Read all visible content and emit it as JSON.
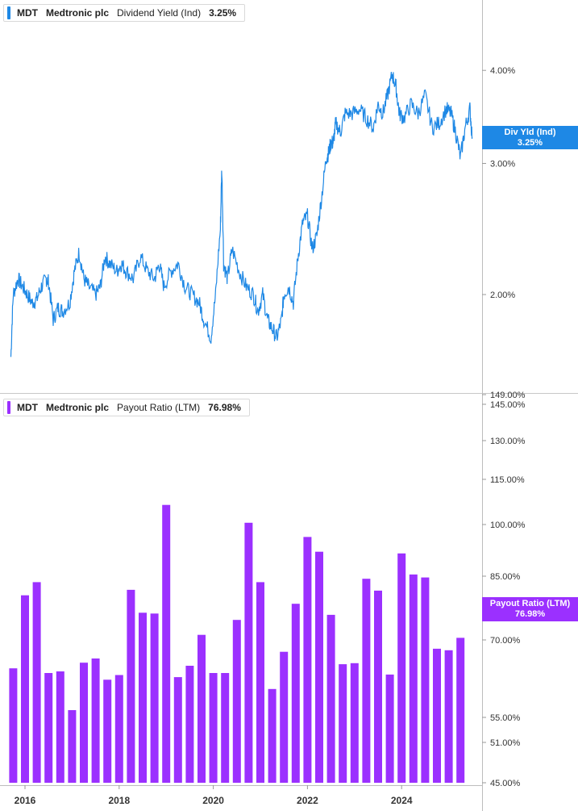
{
  "legend_top": {
    "ticker": "MDT",
    "company": "Medtronic plc",
    "metric": "Dividend Yield (Ind)",
    "value": "3.25%"
  },
  "legend_bottom": {
    "ticker": "MDT",
    "company": "Medtronic plc",
    "metric": "Payout Ratio (LTM)",
    "value": "76.98%"
  },
  "tag_top": {
    "line1": "Div Yld (Ind)",
    "line2": "3.25%"
  },
  "tag_bottom": {
    "line1": "Payout Ratio (LTM)",
    "line2": "76.98%"
  },
  "colors": {
    "yield": "#1e88e5",
    "payout": "#9b30ff",
    "grid": "#d0d0d0"
  },
  "chart_data": [
    {
      "type": "line",
      "x_range": [
        2015.7,
        2025.85
      ],
      "ylim": [
        1.5,
        4.3
      ],
      "yticks": [
        {
          "v": 4.0,
          "label": "4.00%"
        },
        {
          "v": 3.0,
          "label": "3.00%"
        },
        {
          "v": 2.0,
          "label": "2.00%"
        }
      ],
      "series": [
        {
          "name": "Dividend Yield (Ind)",
          "x": [
            2015.7,
            2015.75,
            2015.85,
            2015.95,
            2016.05,
            2016.15,
            2016.25,
            2016.35,
            2016.45,
            2016.5,
            2016.6,
            2016.7,
            2016.8,
            2016.95,
            2017.05,
            2017.15,
            2017.25,
            2017.35,
            2017.5,
            2017.6,
            2017.7,
            2017.8,
            2017.95,
            2018.05,
            2018.15,
            2018.3,
            2018.45,
            2018.6,
            2018.75,
            2018.85,
            2018.95,
            2019.1,
            2019.25,
            2019.4,
            2019.55,
            2019.7,
            2019.8,
            2019.95,
            2020.05,
            2020.15,
            2020.18,
            2020.22,
            2020.3,
            2020.4,
            2020.55,
            2020.7,
            2020.85,
            2020.95,
            2021.05,
            2021.15,
            2021.25,
            2021.35,
            2021.45,
            2021.5,
            2021.6,
            2021.7,
            2021.8,
            2021.9,
            2022.0,
            2022.1,
            2022.2,
            2022.3,
            2022.4,
            2022.45,
            2022.5,
            2022.55,
            2022.6,
            2022.7,
            2022.8,
            2022.95,
            2023.1,
            2023.25,
            2023.4,
            2023.5,
            2023.6,
            2023.7,
            2023.8,
            2023.88,
            2023.95,
            2024.05,
            2024.2,
            2024.35,
            2024.5,
            2024.65,
            2024.8,
            2024.95,
            2025.05,
            2025.15,
            2025.25,
            2025.35,
            2025.45,
            2025.5
          ],
          "y": [
            1.65,
            2.0,
            2.1,
            2.05,
            2.0,
            1.95,
            1.97,
            2.05,
            2.1,
            2.08,
            1.85,
            1.92,
            1.9,
            1.95,
            2.15,
            2.28,
            2.1,
            2.05,
            2.0,
            2.05,
            2.25,
            2.2,
            2.15,
            2.2,
            2.15,
            2.1,
            2.25,
            2.15,
            2.1,
            2.2,
            2.05,
            2.15,
            2.2,
            2.05,
            2.0,
            1.95,
            1.85,
            1.75,
            2.0,
            2.45,
            2.95,
            2.2,
            2.1,
            2.3,
            2.15,
            2.05,
            2.0,
            1.9,
            2.0,
            1.85,
            1.8,
            1.75,
            1.85,
            2.0,
            2.05,
            1.95,
            2.25,
            2.5,
            2.55,
            2.3,
            2.4,
            2.7,
            3.05,
            3.1,
            3.2,
            3.2,
            3.4,
            3.3,
            3.5,
            3.5,
            3.55,
            3.45,
            3.35,
            3.6,
            3.5,
            3.7,
            3.95,
            3.8,
            3.5,
            3.45,
            3.6,
            3.5,
            3.7,
            3.35,
            3.4,
            3.55,
            3.5,
            3.3,
            3.05,
            3.35,
            3.55,
            3.25
          ]
        }
      ]
    },
    {
      "type": "bar",
      "ylim": [
        45,
        150
      ],
      "yticks": [
        {
          "v": 149,
          "label": "149.00%"
        },
        {
          "v": 145,
          "label": "145.00%"
        },
        {
          "v": 130,
          "label": "130.00%"
        },
        {
          "v": 115,
          "label": "115.00%"
        },
        {
          "v": 100,
          "label": "100.00%"
        },
        {
          "v": 85,
          "label": "85.00%"
        },
        {
          "v": 70,
          "label": "70.00%"
        },
        {
          "v": 55,
          "label": "55.00%"
        },
        {
          "v": 51,
          "label": "51.00%"
        },
        {
          "v": 45,
          "label": "45.00%"
        }
      ],
      "x_labels": [
        "2016",
        "2018",
        "2020",
        "2022",
        "2024"
      ],
      "x_label_positions": [
        2016,
        2018,
        2020,
        2022,
        2024
      ],
      "series": [
        {
          "name": "Payout Ratio (LTM)",
          "x": [
            2015.75,
            2016.0,
            2016.25,
            2016.5,
            2016.75,
            2017.0,
            2017.25,
            2017.5,
            2017.75,
            2018.0,
            2018.25,
            2018.5,
            2018.75,
            2019.0,
            2019.25,
            2019.5,
            2019.75,
            2020.0,
            2020.25,
            2020.5,
            2020.75,
            2021.0,
            2021.25,
            2021.5,
            2021.75,
            2022.0,
            2022.25,
            2022.5,
            2022.75,
            2023.0,
            2023.25,
            2023.5,
            2023.75,
            2024.0,
            2024.25,
            2024.5,
            2024.75,
            2025.0,
            2025.25
          ],
          "values": [
            64.5,
            80.5,
            83.6,
            63.6,
            63.9,
            56.4,
            65.6,
            66.4,
            62.3,
            63.2,
            81.8,
            76.4,
            76.2,
            106.5,
            62.8,
            65.0,
            71.2,
            63.6,
            63.6,
            74.7,
            100.6,
            83.6,
            60.5,
            67.7,
            78.5,
            96.4,
            92.1,
            75.9,
            65.3,
            65.5,
            84.4,
            81.6,
            63.3,
            91.6,
            85.5,
            84.7,
            68.3,
            68.0,
            70.5
          ]
        }
      ]
    }
  ]
}
